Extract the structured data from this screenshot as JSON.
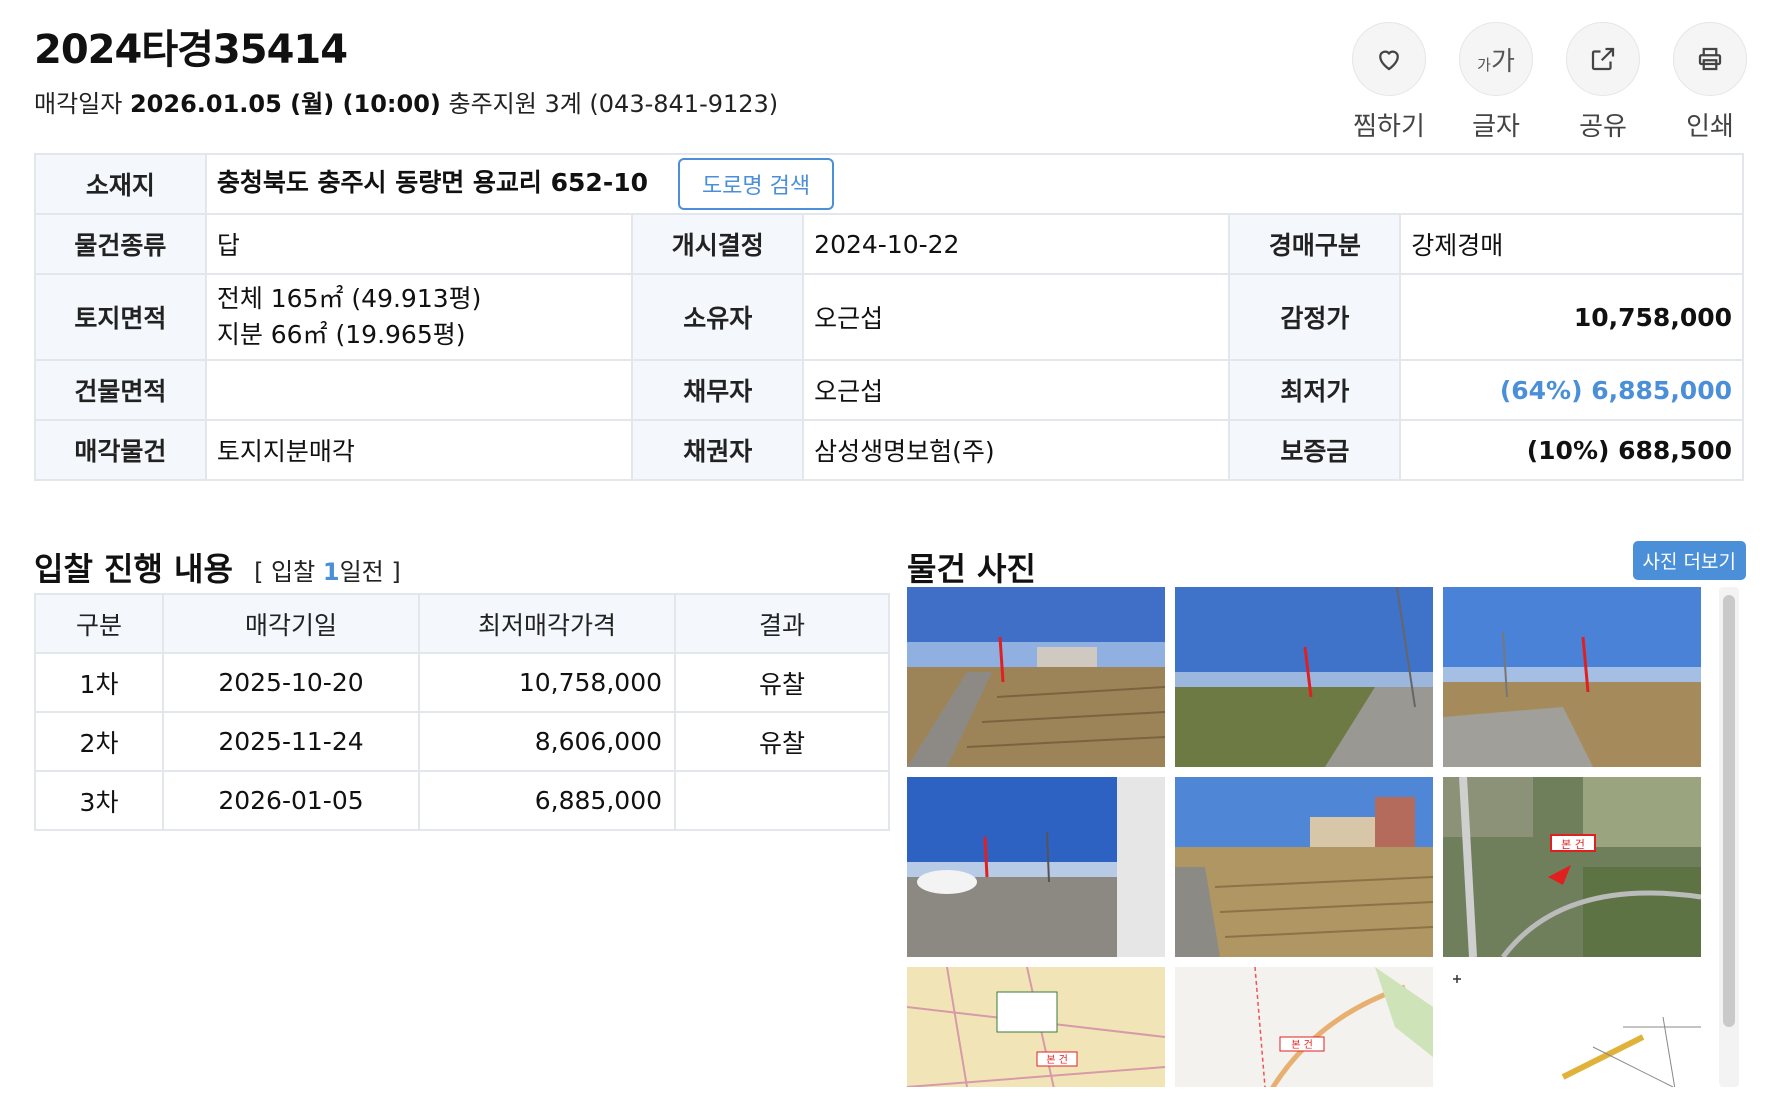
{
  "header": {
    "case_number": "2024타경35414",
    "sale_label": "매각일자",
    "sale_datetime": "2026.01.05 (월) (10:00)",
    "court": "충주지원 3계 (043-841-9123)"
  },
  "actions": [
    {
      "label": "찜하기",
      "icon": "heart-icon"
    },
    {
      "label": "글자",
      "icon": "font-size-icon",
      "glyph_small": "가",
      "glyph_big": "가"
    },
    {
      "label": "공유",
      "icon": "share-icon"
    },
    {
      "label": "인쇄",
      "icon": "print-icon"
    }
  ],
  "info": {
    "address_label": "소재지",
    "address": "충청북도 충주시 동량면 용교리 652-10",
    "road_search_button": "도로명 검색",
    "rows": {
      "item_type_label": "물건종류",
      "item_type": "답",
      "start_label": "개시결정",
      "start_date": "2024-10-22",
      "auction_type_label": "경매구분",
      "auction_type": "강제경매",
      "land_area_label": "토지면적",
      "land_total": "전체 165㎡ (49.913평)",
      "land_share": "지분 66㎡ (19.965평)",
      "owner_label": "소유자",
      "owner": "오근섭",
      "appraisal_label": "감정가",
      "appraisal": "10,758,000",
      "building_area_label": "건물면적",
      "building_area": "",
      "debtor_label": "채무자",
      "debtor": "오근섭",
      "min_price_label": "최저가",
      "min_price": "(64%) 6,885,000",
      "sale_item_label": "매각물건",
      "sale_item": "토지지분매각",
      "creditor_label": "채권자",
      "creditor": "삼성생명보험(주)",
      "deposit_label": "보증금",
      "deposit": "(10%) 688,500"
    }
  },
  "bidding": {
    "title": "입찰 진행 내용",
    "sub_prefix": "[ 입찰",
    "days_left": "1",
    "sub_suffix": "일전 ]",
    "columns": [
      "구분",
      "매각기일",
      "최저매각가격",
      "결과"
    ],
    "rows": [
      {
        "round": "1차",
        "date": "2025-10-20",
        "price": "10,758,000",
        "result": "유찰"
      },
      {
        "round": "2차",
        "date": "2025-11-24",
        "price": "8,606,000",
        "result": "유찰"
      },
      {
        "round": "3차",
        "date": "2026-01-05",
        "price": "6,885,000",
        "result": ""
      }
    ]
  },
  "photos": {
    "title": "물건 사진",
    "more_button": "사진 더보기",
    "map_label": "본 건",
    "items": [
      {
        "kind": "field-photo"
      },
      {
        "kind": "field-photo"
      },
      {
        "kind": "field-photo"
      },
      {
        "kind": "field-photo"
      },
      {
        "kind": "field-photo"
      },
      {
        "kind": "aerial-map"
      },
      {
        "kind": "cadastral-map"
      },
      {
        "kind": "road-map"
      },
      {
        "kind": "survey-map"
      }
    ]
  },
  "colors": {
    "accent": "#4a8fd8",
    "header_bg": "#f4f7fb",
    "border": "#e3e7ec"
  }
}
